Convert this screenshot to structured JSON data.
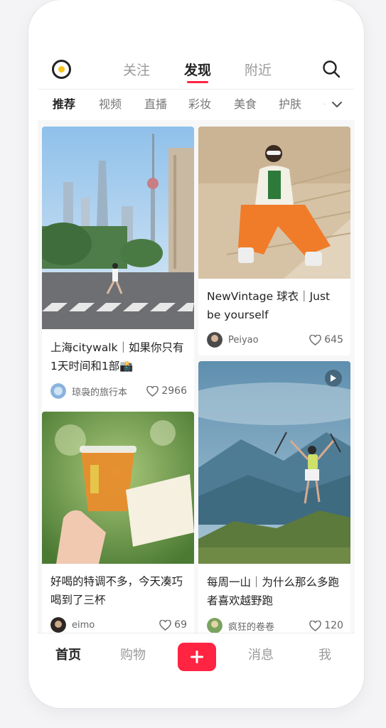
{
  "header": {
    "tabs": [
      {
        "label": "关注",
        "active": false
      },
      {
        "label": "发现",
        "active": true
      },
      {
        "label": "附近",
        "active": false
      }
    ]
  },
  "categories": [
    "推荐",
    "视频",
    "直播",
    "彩妆",
    "美食",
    "护肤"
  ],
  "feed": [
    {
      "title": "上海citywalk｜如果你只有1天时间和1部📸",
      "author": "琼袅的旅行本",
      "likes": "2966",
      "is_video": false
    },
    {
      "title": "NewVintage 球衣｜Just be yourself",
      "author": "Peiyao",
      "likes": "645",
      "is_video": false
    },
    {
      "title": "好喝的特调不多，今天凑巧喝到了三杯",
      "author": "eimo",
      "likes": "69",
      "is_video": false
    },
    {
      "title": "每周一山｜为什么那么多跑者喜欢越野跑",
      "author": "疯狂的卷卷",
      "likes": "120",
      "is_video": true
    }
  ],
  "bottom_nav": {
    "home": "首页",
    "shop": "购物",
    "messages": "消息",
    "me": "我"
  },
  "colors": {
    "accent": "#ff2442",
    "logo_dot": "#f5c518"
  }
}
